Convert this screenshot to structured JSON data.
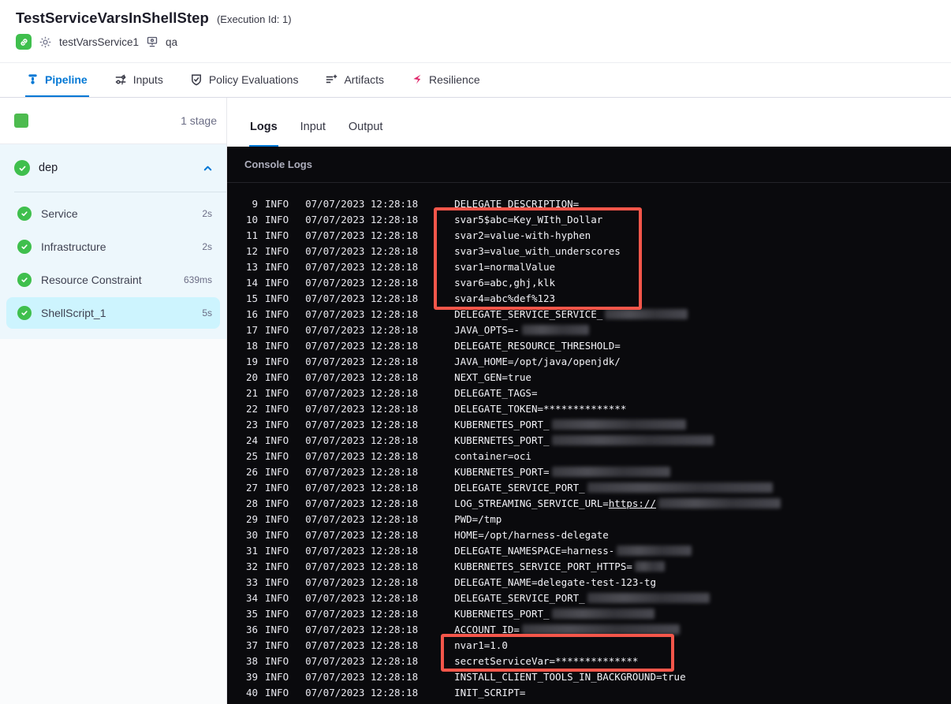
{
  "header": {
    "title": "TestServiceVarsInShellStep",
    "execution_id": "(Execution Id: 1)",
    "service_name": "testVarsService1",
    "environment_name": "qa"
  },
  "nav_tabs": {
    "items": [
      {
        "label": "Pipeline",
        "icon": "pipeline-icon",
        "active": true
      },
      {
        "label": "Inputs",
        "icon": "inputs-icon",
        "active": false
      },
      {
        "label": "Policy Evaluations",
        "icon": "policy-shield-icon",
        "active": false
      },
      {
        "label": "Artifacts",
        "icon": "artifacts-icon",
        "active": false
      },
      {
        "label": "Resilience",
        "icon": "resilience-icon",
        "active": false
      }
    ]
  },
  "sidebar": {
    "stage_count": "1 stage",
    "stage_group": {
      "name": "dep",
      "status": "success",
      "expanded": true
    },
    "steps": [
      {
        "name": "Service",
        "duration": "2s",
        "status": "success",
        "selected": false
      },
      {
        "name": "Infrastructure",
        "duration": "2s",
        "status": "success",
        "selected": false
      },
      {
        "name": "Resource Constraint",
        "duration": "639ms",
        "status": "success",
        "selected": false
      },
      {
        "name": "ShellScript_1",
        "duration": "5s",
        "status": "success",
        "selected": true
      }
    ]
  },
  "log_tabs": {
    "items": [
      {
        "label": "Logs",
        "active": true
      },
      {
        "label": "Input",
        "active": false
      },
      {
        "label": "Output",
        "active": false
      }
    ]
  },
  "console": {
    "title": "Console Logs",
    "level": "INFO",
    "timestamp": "07/07/2023 12:28:18",
    "lines": [
      {
        "num": 9,
        "msg": "DELEGATE_DESCRIPTION="
      },
      {
        "num": 10,
        "msg": "svar5$abc=Key_WIth_Dollar"
      },
      {
        "num": 11,
        "msg": "svar2=value-with-hyphen"
      },
      {
        "num": 12,
        "msg": "svar3=value_with_underscores"
      },
      {
        "num": 13,
        "msg": "svar1=normalValue"
      },
      {
        "num": 14,
        "msg": "svar6=abc,ghj,klk"
      },
      {
        "num": 15,
        "msg": "svar4=abc%def%123"
      },
      {
        "num": 16,
        "msg": "DELEGATE_SERVICE_SERVICE_",
        "redact_width": 105
      },
      {
        "num": 17,
        "msg": "JAVA_OPTS=-",
        "redact_width": 85
      },
      {
        "num": 18,
        "msg": "DELEGATE_RESOURCE_THRESHOLD="
      },
      {
        "num": 19,
        "msg": "JAVA_HOME=/opt/java/openjdk/"
      },
      {
        "num": 20,
        "msg": "NEXT_GEN=true"
      },
      {
        "num": 21,
        "msg": "DELEGATE_TAGS="
      },
      {
        "num": 22,
        "msg": "DELEGATE_TOKEN=**************"
      },
      {
        "num": 23,
        "msg": "KUBERNETES_PORT_",
        "redact_width": 170
      },
      {
        "num": 24,
        "msg": "KUBERNETES_PORT_",
        "redact_width": 205
      },
      {
        "num": 25,
        "msg": "container=oci"
      },
      {
        "num": 26,
        "msg": "KUBERNETES_PORT=",
        "redact_width": 150
      },
      {
        "num": 27,
        "msg": "DELEGATE_SERVICE_PORT_",
        "redact_width": 235
      },
      {
        "num": 28,
        "msg": "LOG_STREAMING_SERVICE_URL=",
        "link": "https://",
        "redact_width": 155
      },
      {
        "num": 29,
        "msg": "PWD=/tmp"
      },
      {
        "num": 30,
        "msg": "HOME=/opt/harness-delegate"
      },
      {
        "num": 31,
        "msg": "DELEGATE_NAMESPACE=harness-",
        "redact_width": 95
      },
      {
        "num": 32,
        "msg": "KUBERNETES_SERVICE_PORT_HTTPS=",
        "redact_width": 38
      },
      {
        "num": 33,
        "msg": "DELEGATE_NAME=delegate-test-123-tg"
      },
      {
        "num": 34,
        "msg": "DELEGATE_SERVICE_PORT_",
        "redact_width": 155
      },
      {
        "num": 35,
        "msg": "KUBERNETES_PORT_",
        "redact_width": 130
      },
      {
        "num": 36,
        "msg": "ACCOUNT_ID=",
        "redact_width": 200
      },
      {
        "num": 37,
        "msg": "nvar1=1.0"
      },
      {
        "num": 38,
        "msg": "secretServiceVar=**************"
      },
      {
        "num": 39,
        "msg": "INSTALL_CLIENT_TOOLS_IN_BACKGROUND=true"
      },
      {
        "num": 40,
        "msg": "INIT_SCRIPT="
      }
    ],
    "highlights": [
      {
        "lines": "10-15",
        "note": "service variables"
      },
      {
        "lines": "37-38",
        "note": "nvar1 and secretServiceVar"
      }
    ]
  },
  "colors": {
    "accent_blue": "#0278d5",
    "success_green": "#3fbf4d",
    "highlight_red": "#f4564a",
    "selected_step_bg": "#cdf4fe",
    "console_bg": "#0a0a0d",
    "resilience_pink": "#e0286b"
  }
}
